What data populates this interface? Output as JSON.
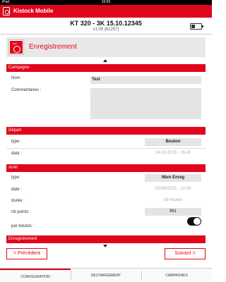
{
  "status_bar": {
    "carrier": "iPad",
    "time": "16:50",
    "battery": ""
  },
  "app": {
    "title": "Kistock Mobile"
  },
  "device": {
    "name": "KT 320 - 3K 15.10.12345",
    "version": "v1.00 (b1257)"
  },
  "section": {
    "title": "Enregistrement"
  },
  "campagne": {
    "header": "Campagne",
    "nom_label": "Nom :",
    "nom_value": "Test",
    "commentaires_label": "Commentaires :",
    "commentaires_value": ""
  },
  "depart": {
    "header": "Départ",
    "type_label": "type :",
    "type_value": "Bouton",
    "date_label": "date :",
    "date_value": "14-10-2015 - 16:41"
  },
  "arret": {
    "header": "Arrêt",
    "type_label": "type :",
    "type_value": "Nbre Enreg",
    "date_label": "date :",
    "date_value": "02/06/2015 - 12:00",
    "duree_label": "durée :",
    "duree_value": "16 heures",
    "nbpoints_label": "nb points :",
    "nbpoints_value": "961",
    "parbouton_label": "par bouton :",
    "parbouton_on": true
  },
  "enregistrement": {
    "header": "Enregistrement"
  },
  "nav": {
    "prev": "< Précédent",
    "next": "Suivant >"
  },
  "tabs": [
    {
      "label": "CONFIGURATION",
      "active": true
    },
    {
      "label": "DECHARGEMENT",
      "active": false
    },
    {
      "label": "CAMPAGNES",
      "active": false
    }
  ],
  "colors": {
    "accent": "#e0061b",
    "field_bg": "#e4e4e4"
  },
  "icons": {
    "app_logo": "kistock-logo-icon",
    "section": "recording-icon",
    "battery": "battery-icon"
  }
}
